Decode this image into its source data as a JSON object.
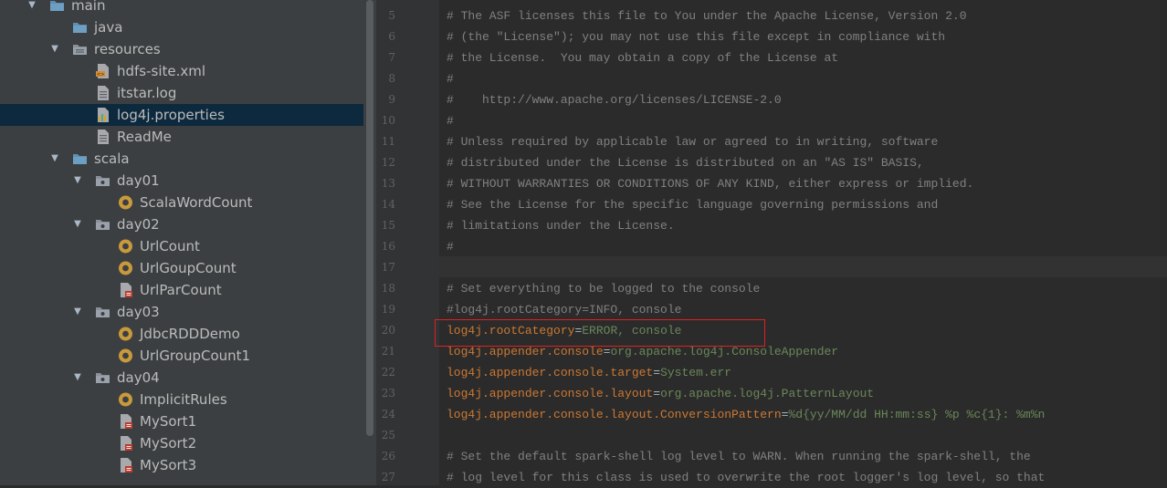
{
  "tree": {
    "items": [
      {
        "label": "main",
        "icon": "folder-icon",
        "expanded": true
      },
      {
        "label": "java",
        "icon": "folder-icon"
      },
      {
        "label": "resources",
        "icon": "resources-folder-icon",
        "expanded": true
      },
      {
        "label": "hdfs-site.xml",
        "icon": "xml-file-icon"
      },
      {
        "label": "itstar.log",
        "icon": "text-file-icon"
      },
      {
        "label": "log4j.properties",
        "icon": "properties-file-icon",
        "selected": true
      },
      {
        "label": "ReadMe",
        "icon": "text-file-icon"
      },
      {
        "label": "scala",
        "icon": "folder-icon",
        "expanded": true
      },
      {
        "label": "day01",
        "icon": "package-icon",
        "expanded": true
      },
      {
        "label": "ScalaWordCount",
        "icon": "scala-object-icon"
      },
      {
        "label": "day02",
        "icon": "package-icon",
        "expanded": true
      },
      {
        "label": "UrlCount",
        "icon": "scala-object-icon"
      },
      {
        "label": "UrlGoupCount",
        "icon": "scala-object-icon"
      },
      {
        "label": "UrlParCount",
        "icon": "scala-file-icon"
      },
      {
        "label": "day03",
        "icon": "package-icon",
        "expanded": true
      },
      {
        "label": "JdbcRDDDemo",
        "icon": "scala-object-icon"
      },
      {
        "label": "UrlGroupCount1",
        "icon": "scala-object-icon"
      },
      {
        "label": "day04",
        "icon": "package-icon",
        "expanded": true
      },
      {
        "label": "ImplicitRules",
        "icon": "scala-object-icon"
      },
      {
        "label": "MySort1",
        "icon": "scala-file-icon"
      },
      {
        "label": "MySort2",
        "icon": "scala-file-icon"
      },
      {
        "label": "MySort3",
        "icon": "scala-file-icon"
      }
    ]
  },
  "editor": {
    "lines": [
      {
        "n": "5",
        "parts": [
          {
            "t": "# The ASF licenses this file to You under the Apache License, Version 2.0",
            "c": "comment"
          }
        ]
      },
      {
        "n": "6",
        "parts": [
          {
            "t": "# (the \"License\"); you may not use this file except in compliance with",
            "c": "comment"
          }
        ]
      },
      {
        "n": "7",
        "parts": [
          {
            "t": "# the License.  You may obtain a copy of the License at",
            "c": "comment"
          }
        ]
      },
      {
        "n": "8",
        "parts": [
          {
            "t": "#",
            "c": "comment"
          }
        ]
      },
      {
        "n": "9",
        "parts": [
          {
            "t": "#    http://www.apache.org/licenses/LICENSE-2.0",
            "c": "comment"
          }
        ]
      },
      {
        "n": "10",
        "parts": [
          {
            "t": "#",
            "c": "comment"
          }
        ]
      },
      {
        "n": "11",
        "parts": [
          {
            "t": "# Unless required by applicable law or agreed to in writing, software",
            "c": "comment"
          }
        ]
      },
      {
        "n": "12",
        "parts": [
          {
            "t": "# distributed under the License is distributed on an \"AS IS\" BASIS,",
            "c": "comment"
          }
        ]
      },
      {
        "n": "13",
        "parts": [
          {
            "t": "# WITHOUT WARRANTIES OR CONDITIONS OF ANY KIND, either express or implied.",
            "c": "comment"
          }
        ]
      },
      {
        "n": "14",
        "parts": [
          {
            "t": "# See the License for the specific language governing permissions and",
            "c": "comment"
          }
        ]
      },
      {
        "n": "15",
        "parts": [
          {
            "t": "# limitations under the License.",
            "c": "comment"
          }
        ]
      },
      {
        "n": "16",
        "parts": [
          {
            "t": "#",
            "c": "comment"
          }
        ]
      },
      {
        "n": "17",
        "parts": []
      },
      {
        "n": "18",
        "parts": [
          {
            "t": "# Set everything to be logged to the console",
            "c": "comment"
          }
        ]
      },
      {
        "n": "19",
        "parts": [
          {
            "t": "#log4j.rootCategory=INFO, console",
            "c": "comment"
          }
        ]
      },
      {
        "n": "20",
        "parts": [
          {
            "t": "log4j.rootCategory",
            "c": "key"
          },
          {
            "t": "=",
            "c": "eq"
          },
          {
            "t": "ERROR, console",
            "c": "val"
          }
        ]
      },
      {
        "n": "21",
        "parts": [
          {
            "t": "log4j.appender.console",
            "c": "key"
          },
          {
            "t": "=",
            "c": "eq"
          },
          {
            "t": "org.apache.log4j.ConsoleAppender",
            "c": "val"
          }
        ]
      },
      {
        "n": "22",
        "parts": [
          {
            "t": "log4j.appender.console.target",
            "c": "key"
          },
          {
            "t": "=",
            "c": "eq"
          },
          {
            "t": "System.err",
            "c": "val"
          }
        ]
      },
      {
        "n": "23",
        "parts": [
          {
            "t": "log4j.appender.console.layout",
            "c": "key"
          },
          {
            "t": "=",
            "c": "eq"
          },
          {
            "t": "org.apache.log4j.PatternLayout",
            "c": "val"
          }
        ]
      },
      {
        "n": "24",
        "parts": [
          {
            "t": "log4j.appender.console.layout.ConversionPattern",
            "c": "key"
          },
          {
            "t": "=",
            "c": "eq"
          },
          {
            "t": "%d{yy/MM/dd HH:mm:ss} %p %c{1}: %m%n",
            "c": "val"
          }
        ]
      },
      {
        "n": "25",
        "parts": []
      },
      {
        "n": "26",
        "parts": [
          {
            "t": "# Set the default spark-shell log level to WARN. When running the spark-shell, the",
            "c": "comment"
          }
        ]
      },
      {
        "n": "27",
        "parts": [
          {
            "t": "# log level for this class is used to overwrite the root logger's log level, so that",
            "c": "comment"
          }
        ]
      }
    ]
  },
  "colors": {
    "tree_bg": "#3c3f41",
    "selection": "#0d293e",
    "editor_bg": "#2b2b2b",
    "comment": "#808080",
    "key": "#cc7832",
    "value": "#6a8759",
    "annotation_box": "#e02020"
  }
}
